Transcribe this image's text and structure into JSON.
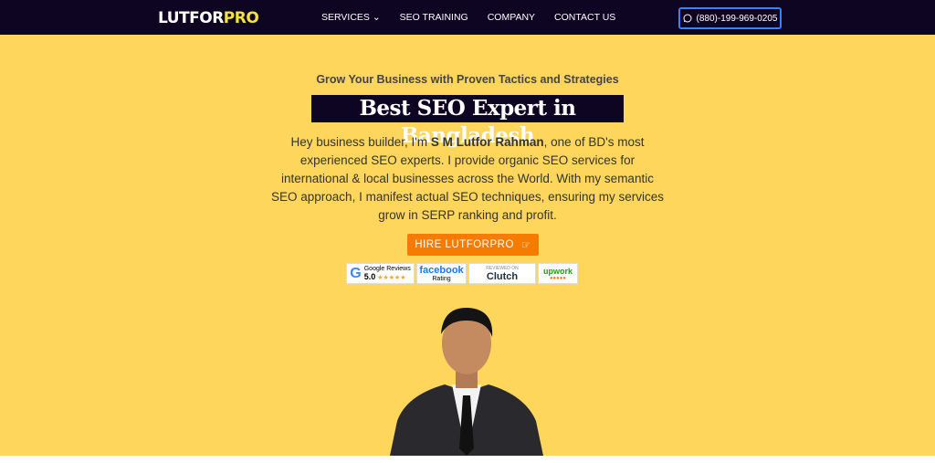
{
  "header": {
    "logo_main": "LUTFOR",
    "logo_accent": "PRO",
    "nav": [
      {
        "label": "SERVICES ⌄"
      },
      {
        "label": "SEO TRAINING"
      },
      {
        "label": "COMPANY"
      },
      {
        "label": "CONTACT US"
      }
    ],
    "phone": "(880)-199-969-0205",
    "phone_icon": "whatsapp-icon"
  },
  "hero": {
    "tagline": "Grow Your Business with Proven Tactics and Strategies",
    "title": "Best SEO Expert in Bangladesh",
    "desc_pre": "Hey business builder, I'm ",
    "desc_name": "S M Lutfor Rahman",
    "desc_post": ", one of BD's most experienced SEO experts. I provide organic SEO services for international & local businesses across the World. With my semantic SEO  approach, I manifest actual SEO techniques, ensuring my services grow in SERP ranking and profit.",
    "hire_label": "HIRE LUTFORPRO",
    "hire_icon": "pointing-hand-icon"
  },
  "badges": {
    "google": {
      "title": "Google Reviews",
      "score": "5.0",
      "stars": "★★★★★"
    },
    "facebook": {
      "title": "facebook",
      "sub": "Rating"
    },
    "clutch": {
      "top": "REVIEWED ON",
      "name": "Clutch",
      "sub": "REVIEWS"
    },
    "upwork": {
      "name": "upwork"
    }
  },
  "colors": {
    "header": "#0e0523",
    "hero": "#ffd65c",
    "accent": "#f57c00",
    "logo_accent": "#f5e23a"
  }
}
